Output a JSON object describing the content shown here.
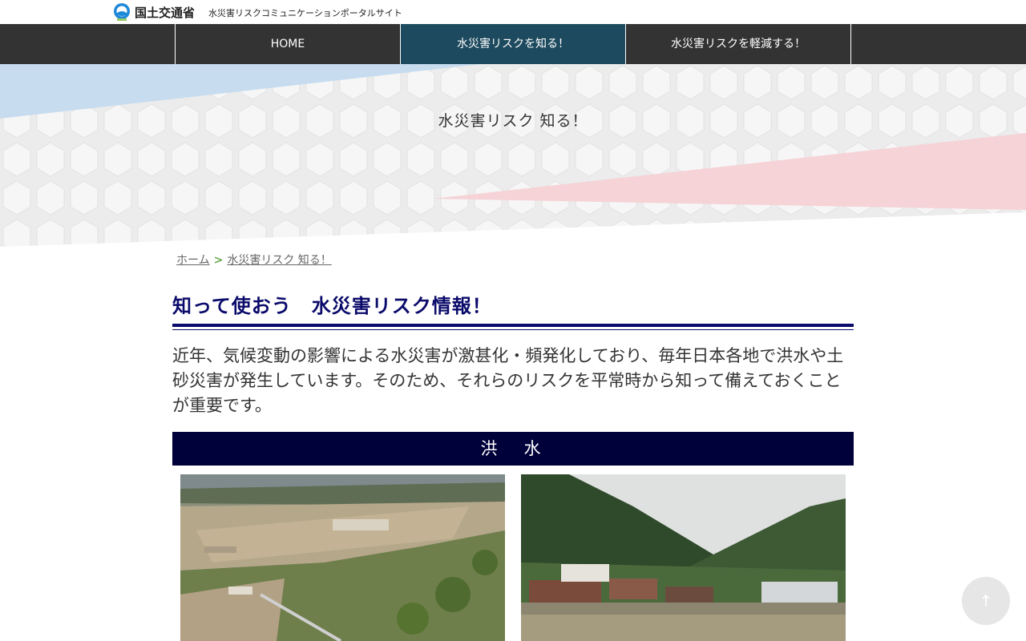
{
  "header": {
    "ministry_logo_text": "国土交通省",
    "site_title": "水災害リスクコミュニケーションポータルサイト"
  },
  "nav": {
    "items": [
      {
        "label": "HOME"
      },
      {
        "label": "水災害リスクを知る！",
        "active": true
      },
      {
        "label": "水災害リスクを軽減する！"
      }
    ]
  },
  "hero": {
    "title": "水災害リスク 知る！",
    "colors": {
      "blue": "#c7dcef",
      "pink": "#f5d3d6",
      "hex_bg": "#eeeeee"
    }
  },
  "breadcrumb": {
    "home": "ホーム",
    "separator": ">",
    "current": "水災害リスク 知る！"
  },
  "main": {
    "heading": "知って使おう　水災害リスク情報！",
    "intro": "近年、気候変動の影響による水災害が激甚化・頻発化しており、毎年日本各地で洪水や土砂災害が発生しています。そのため、それらのリスクを平常時から知って備えておくことが重要です。",
    "section_title": "洪　水",
    "photos": [
      {
        "alt": "flooded town aerial view"
      },
      {
        "alt": "flooded village in mountains"
      }
    ]
  },
  "to_top": {
    "label": "↑"
  },
  "colors": {
    "nav_bg": "#333333",
    "nav_active": "#1d4a5e",
    "heading": "#0b0b6b",
    "section_bar": "#00003a"
  }
}
